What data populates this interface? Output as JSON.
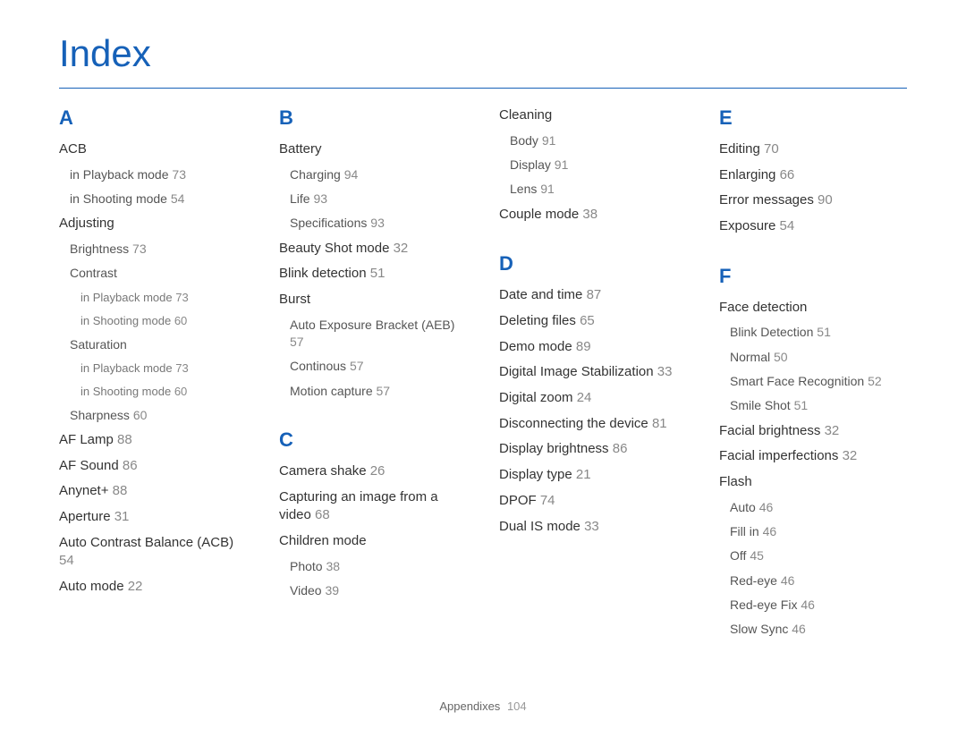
{
  "title": "Index",
  "footer": {
    "label": "Appendixes",
    "page": "104"
  },
  "columns": [
    {
      "blocks": [
        {
          "letter": "A"
        },
        {
          "h": "ACB",
          "lvl": 1
        },
        {
          "h": "in Playback mode",
          "p": "73",
          "lvl": 2
        },
        {
          "h": "in Shooting mode",
          "p": "54",
          "lvl": 2
        },
        {
          "h": "Adjusting",
          "lvl": 1,
          "mid": true
        },
        {
          "h": "Brightness",
          "p": "73",
          "lvl": 2
        },
        {
          "h": "Contrast",
          "lvl": 2
        },
        {
          "h": "in Playback mode",
          "p": "73",
          "lvl": 3
        },
        {
          "h": "in Shooting mode",
          "p": "60",
          "lvl": 3
        },
        {
          "h": "Saturation",
          "lvl": 2
        },
        {
          "h": "in Playback mode",
          "p": "73",
          "lvl": 3
        },
        {
          "h": "in Shooting mode",
          "p": "60",
          "lvl": 3
        },
        {
          "h": "Sharpness",
          "p": "60",
          "lvl": 2
        },
        {
          "h": "AF Lamp",
          "p": "88",
          "lvl": 1,
          "mid": true
        },
        {
          "h": "AF Sound",
          "p": "86",
          "lvl": 1,
          "mid": true
        },
        {
          "h": "Anynet+",
          "p": "88",
          "lvl": 1,
          "mid": true
        },
        {
          "h": "Aperture",
          "p": "31",
          "lvl": 1,
          "mid": true
        },
        {
          "h": "Auto Contrast Balance (ACB)",
          "p": "54",
          "lvl": 1,
          "mid": true
        },
        {
          "h": "Auto mode",
          "p": "22",
          "lvl": 1,
          "mid": true
        }
      ]
    },
    {
      "blocks": [
        {
          "letter": "B"
        },
        {
          "h": "Battery",
          "lvl": 1
        },
        {
          "h": "Charging",
          "p": "94",
          "lvl": 2
        },
        {
          "h": "Life",
          "p": "93",
          "lvl": 2
        },
        {
          "h": "Specifications",
          "p": "93",
          "lvl": 2
        },
        {
          "h": "Beauty Shot mode",
          "p": "32",
          "lvl": 1,
          "mid": true
        },
        {
          "h": "Blink detection",
          "p": "51",
          "lvl": 1,
          "mid": true
        },
        {
          "h": "Burst",
          "lvl": 1,
          "mid": true
        },
        {
          "h": "Auto Exposure Bracket (AEB)",
          "p": "57",
          "lvl": 2
        },
        {
          "h": "Continous",
          "p": "57",
          "lvl": 2
        },
        {
          "h": "Motion capture",
          "p": "57",
          "lvl": 2
        },
        {
          "letter": "C",
          "top": true
        },
        {
          "h": "Camera shake",
          "p": "26",
          "lvl": 1
        },
        {
          "h": "Capturing an image from a video",
          "p": "68",
          "lvl": 1,
          "mid": true
        },
        {
          "h": "Children mode",
          "lvl": 1,
          "mid": true
        },
        {
          "h": "Photo",
          "p": "38",
          "lvl": 2
        },
        {
          "h": "Video",
          "p": "39",
          "lvl": 2
        }
      ]
    },
    {
      "blocks": [
        {
          "h": "Cleaning",
          "lvl": 1
        },
        {
          "h": "Body",
          "p": "91",
          "lvl": 2
        },
        {
          "h": "Display",
          "p": "91",
          "lvl": 2
        },
        {
          "h": "Lens",
          "p": "91",
          "lvl": 2
        },
        {
          "h": "Couple mode",
          "p": "38",
          "lvl": 1,
          "mid": true
        },
        {
          "letter": "D",
          "top": true
        },
        {
          "h": "Date and time",
          "p": "87",
          "lvl": 1
        },
        {
          "h": "Deleting files",
          "p": "65",
          "lvl": 1,
          "mid": true
        },
        {
          "h": "Demo mode",
          "p": "89",
          "lvl": 1,
          "mid": true
        },
        {
          "h": "Digital Image Stabilization",
          "p": "33",
          "lvl": 1,
          "mid": true
        },
        {
          "h": "Digital zoom",
          "p": "24",
          "lvl": 1,
          "mid": true
        },
        {
          "h": "Disconnecting the device",
          "p": "81",
          "lvl": 1,
          "mid": true
        },
        {
          "h": "Display brightness",
          "p": "86",
          "lvl": 1,
          "mid": true
        },
        {
          "h": "Display type",
          "p": "21",
          "lvl": 1,
          "mid": true
        },
        {
          "h": "DPOF",
          "p": "74",
          "lvl": 1,
          "mid": true
        },
        {
          "h": "Dual IS mode",
          "p": "33",
          "lvl": 1,
          "mid": true
        }
      ]
    },
    {
      "blocks": [
        {
          "letter": "E"
        },
        {
          "h": "Editing",
          "p": "70",
          "lvl": 1
        },
        {
          "h": "Enlarging",
          "p": "66",
          "lvl": 1,
          "mid": true
        },
        {
          "h": "Error messages",
          "p": "90",
          "lvl": 1,
          "mid": true
        },
        {
          "h": "Exposure",
          "p": "54",
          "lvl": 1,
          "mid": true
        },
        {
          "letter": "F",
          "top": true
        },
        {
          "h": "Face detection",
          "lvl": 1
        },
        {
          "h": "Blink Detection",
          "p": "51",
          "lvl": 2
        },
        {
          "h": "Normal",
          "p": "50",
          "lvl": 2
        },
        {
          "h": "Smart Face Recognition",
          "p": "52",
          "lvl": 2
        },
        {
          "h": "Smile Shot",
          "p": "51",
          "lvl": 2
        },
        {
          "h": "Facial brightness",
          "p": "32",
          "lvl": 1,
          "mid": true
        },
        {
          "h": "Facial imperfections",
          "p": "32",
          "lvl": 1,
          "mid": true
        },
        {
          "h": "Flash",
          "lvl": 1,
          "mid": true
        },
        {
          "h": "Auto",
          "p": "46",
          "lvl": 2
        },
        {
          "h": "Fill in",
          "p": "46",
          "lvl": 2
        },
        {
          "h": "Off",
          "p": "45",
          "lvl": 2
        },
        {
          "h": "Red-eye",
          "p": "46",
          "lvl": 2
        },
        {
          "h": "Red-eye Fix",
          "p": "46",
          "lvl": 2
        },
        {
          "h": "Slow Sync",
          "p": "46",
          "lvl": 2
        }
      ]
    }
  ]
}
